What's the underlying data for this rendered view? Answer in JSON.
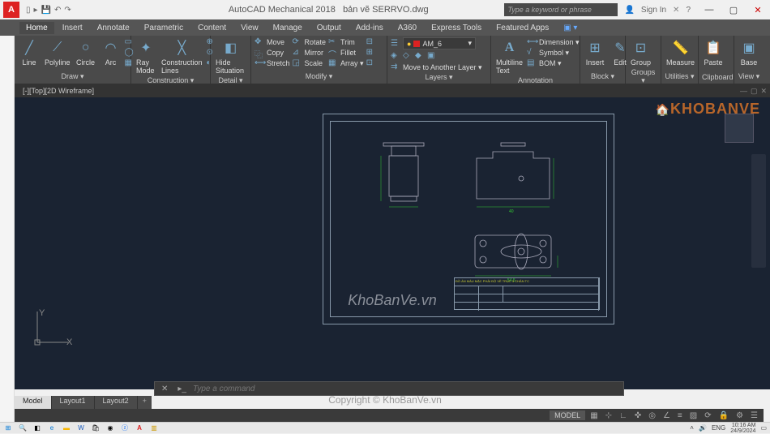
{
  "title": {
    "app": "AutoCAD Mechanical 2018",
    "file": "bản vẽ SERRVO.dwg",
    "search_placeholder": "Type a keyword or phrase",
    "signin": "Sign In"
  },
  "app_icon_letter": "A",
  "menubar": {
    "tabs": [
      "Home",
      "Insert",
      "Annotate",
      "Parametric",
      "Content",
      "View",
      "Manage",
      "Output",
      "Add-ins",
      "A360",
      "Express Tools",
      "Featured Apps"
    ],
    "active": 0
  },
  "ribbon": {
    "draw": {
      "label": "Draw ▾",
      "line": "Line",
      "polyline": "Polyline",
      "circle": "Circle",
      "arc": "Arc",
      "ray": "Ray Mode",
      "construction": "Construction Lines"
    },
    "construction": {
      "label": "Construction ▾"
    },
    "modify": {
      "label": "Modify ▾",
      "move": "Move",
      "copy": "Copy",
      "stretch": "Stretch",
      "rotate": "Rotate",
      "mirror": "Mirror",
      "scale": "Scale",
      "trim": "Trim",
      "fillet": "Fillet",
      "array": "Array ▾"
    },
    "detail": {
      "label": "Detail ▾",
      "hide": "Hide Situation"
    },
    "layers": {
      "label": "Layers ▾",
      "current": "AM_6",
      "move_another": "Move to Another Layer ▾"
    },
    "annotation": {
      "label": "Annotation",
      "multiline": "Multiline Text",
      "dimension": "Dimension ▾",
      "symbol": "Symbol ▾",
      "bom": "BOM ▾"
    },
    "block": {
      "label": "Block ▾",
      "insert": "Insert",
      "edit": "Edit"
    },
    "groups": {
      "label": "Groups ▾",
      "group": "Group"
    },
    "utilities": {
      "label": "Utilities ▾",
      "measure": "Measure"
    },
    "clipboard": {
      "label": "Clipboard",
      "paste": "Paste"
    },
    "base": {
      "label": "View ▾",
      "btn": "Base"
    }
  },
  "doc_tab": "[-][Top][2D Wireframe]",
  "watermark": {
    "logo": "KHOBANVE",
    "center": "KhoBanVe.vn",
    "copyright": "Copyright © KhoBanVe.vn"
  },
  "titleblock": {
    "line1": "ĐỒ ÁN MÀU MẶC PHẢI ĐỘ VỀ TRỤC 3 CHÂN TC"
  },
  "ucs": {
    "x": "X",
    "y": "Y"
  },
  "cmdline": {
    "placeholder": "Type a command"
  },
  "layout_tabs": {
    "items": [
      "Model",
      "Layout1",
      "Layout2"
    ],
    "active": 0,
    "add": "+"
  },
  "statusbar": {
    "model": "MODEL"
  },
  "taskbar": {
    "lang": "ENG",
    "time": "10:16 AM",
    "date": "24/9/2024"
  }
}
